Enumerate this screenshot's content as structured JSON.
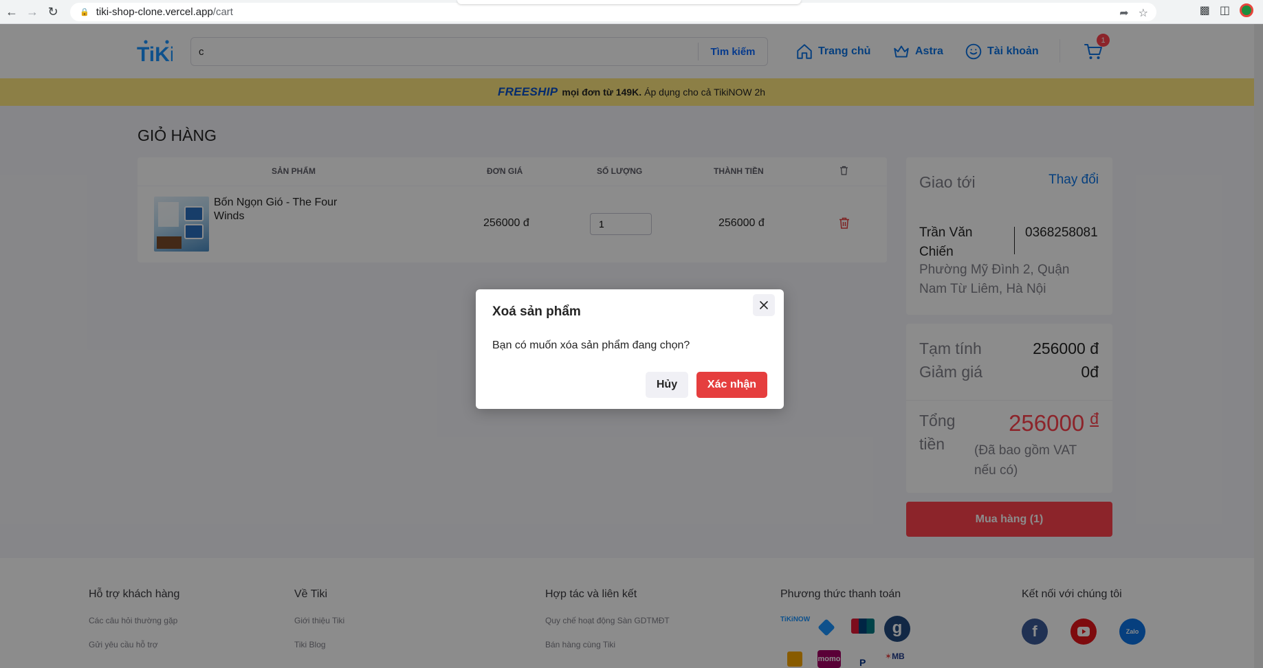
{
  "browser": {
    "url_host": "tiki-shop-clone.vercel.app",
    "url_path": "/cart"
  },
  "header": {
    "search_value": "c",
    "search_button": "Tìm kiếm",
    "nav": {
      "home": "Trang chủ",
      "astra": "Astra",
      "account": "Tài khoản"
    },
    "cart_count": "1"
  },
  "banner": {
    "freeship": "FREESHIP",
    "bold_text": "mọi đơn từ 149K.",
    "rest_text": "Áp dụng cho cả TikiNOW 2h"
  },
  "cart": {
    "title": "GIỎ HÀNG",
    "columns": {
      "product": "SẢN PHẨM",
      "unit_price": "ĐƠN GIÁ",
      "quantity": "SỐ LƯỢNG",
      "total": "THÀNH TIỀN"
    },
    "items": [
      {
        "name": "Bốn Ngọn Gió - The Four Winds",
        "unit_price": "256000 đ",
        "quantity": "1",
        "total": "256000 đ"
      }
    ]
  },
  "shipping": {
    "title": "Giao tới",
    "change": "Thay đổi",
    "name": "Trần Văn Chiến",
    "phone": "0368258081",
    "address": "Phường Mỹ Đình 2, Quận Nam Từ Liêm, Hà Nội"
  },
  "summary": {
    "subtotal_label": "Tạm tính",
    "subtotal_value": "256000 đ",
    "discount_label": "Giảm giá",
    "discount_value": "0đ",
    "total_label": "Tổng tiền",
    "total_value": "256000",
    "total_currency": "đ",
    "vat_note": "(Đã bao gồm VAT nếu có)"
  },
  "buy_button": "Mua hàng (1)",
  "footer": {
    "support": {
      "title": "Hỗ trợ khách hàng",
      "links": [
        "Các câu hỏi thường gặp",
        "Gửi yêu cầu hỗ trợ"
      ]
    },
    "about": {
      "title": "Về Tiki",
      "links": [
        "Giới thiệu Tiki",
        "Tiki Blog"
      ]
    },
    "partner": {
      "title": "Hợp tác và liên kết",
      "links": [
        "Quy chế hoạt động Sàn GDTMĐT",
        "Bán hàng cùng Tiki"
      ]
    },
    "payment": {
      "title": "Phương thức thanh toán",
      "labels": [
        "TiKiNOW",
        "momo",
        "MB"
      ]
    },
    "social": {
      "title": "Kết nối với chúng tôi",
      "zalo_label": "Zalo"
    }
  },
  "modal": {
    "title": "Xoá sản phẩm",
    "message": "Bạn có muốn xóa sản phẩm đang chọn?",
    "cancel": "Hủy",
    "confirm": "Xác nhận"
  },
  "colors": {
    "brand_blue": "#0b74e5",
    "price_red": "#ff424e",
    "confirm_red": "#e53e3e",
    "banner_yellow": "#ffe880"
  }
}
